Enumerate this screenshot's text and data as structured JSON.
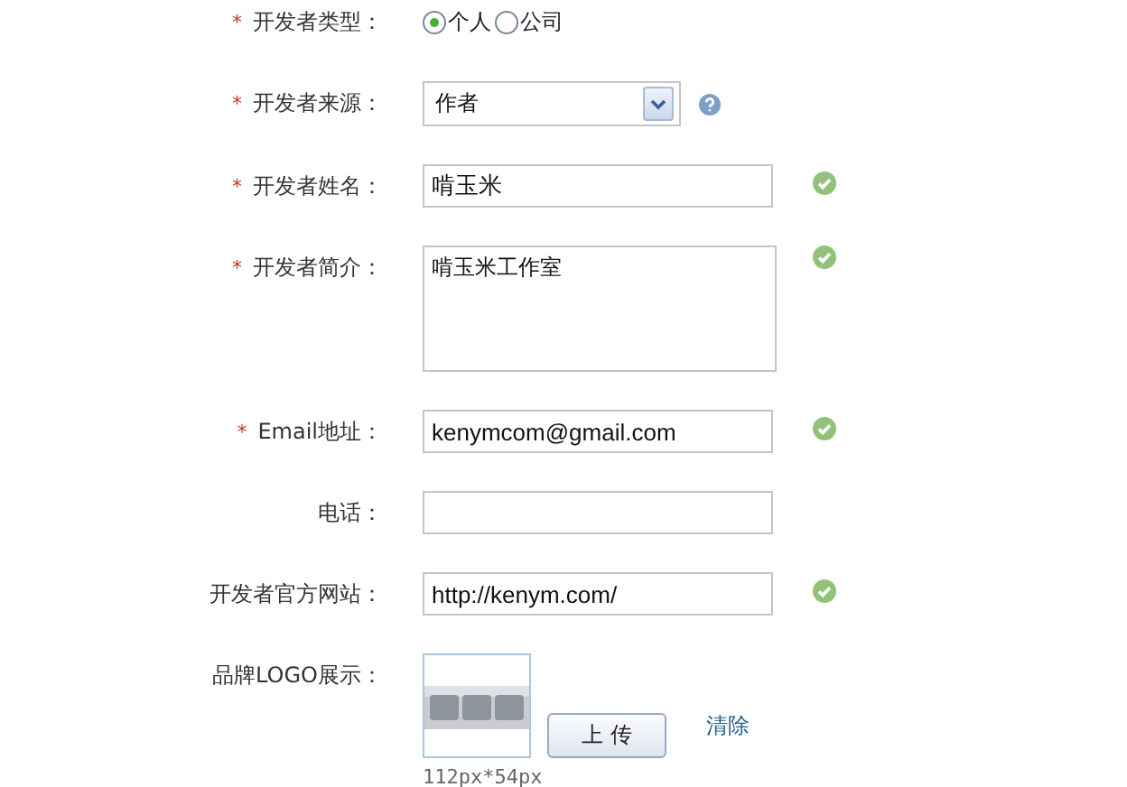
{
  "form": {
    "rows": [
      {
        "kind": "radio",
        "marker": "*",
        "label": "开发者类型：",
        "options": [
          {
            "label": "个人",
            "selected": true
          },
          {
            "label": "公司",
            "selected": false
          }
        ]
      },
      {
        "kind": "select",
        "marker": "*",
        "label": "开发者来源：",
        "value": "作者",
        "help": true
      },
      {
        "kind": "text",
        "marker": "*",
        "label": "开发者姓名：",
        "value": "啃玉米",
        "valid": true
      },
      {
        "kind": "textarea",
        "marker": "*",
        "label": "开发者简介：",
        "value": "啃玉米工作室",
        "valid": true
      },
      {
        "kind": "text",
        "marker": "*",
        "label": "Email地址：",
        "value": "kenymcom@gmail.com",
        "valid": true
      },
      {
        "kind": "text",
        "label": "电话：",
        "valid": false
      },
      {
        "kind": "text",
        "label": "开发者官方网站：",
        "value": "http://kenym.com/",
        "valid": true
      },
      {
        "kind": "logo",
        "label": "品牌LOGO展示：",
        "upload": "上 传",
        "clear": "清除",
        "size_hint": "112px*54px"
      }
    ]
  }
}
